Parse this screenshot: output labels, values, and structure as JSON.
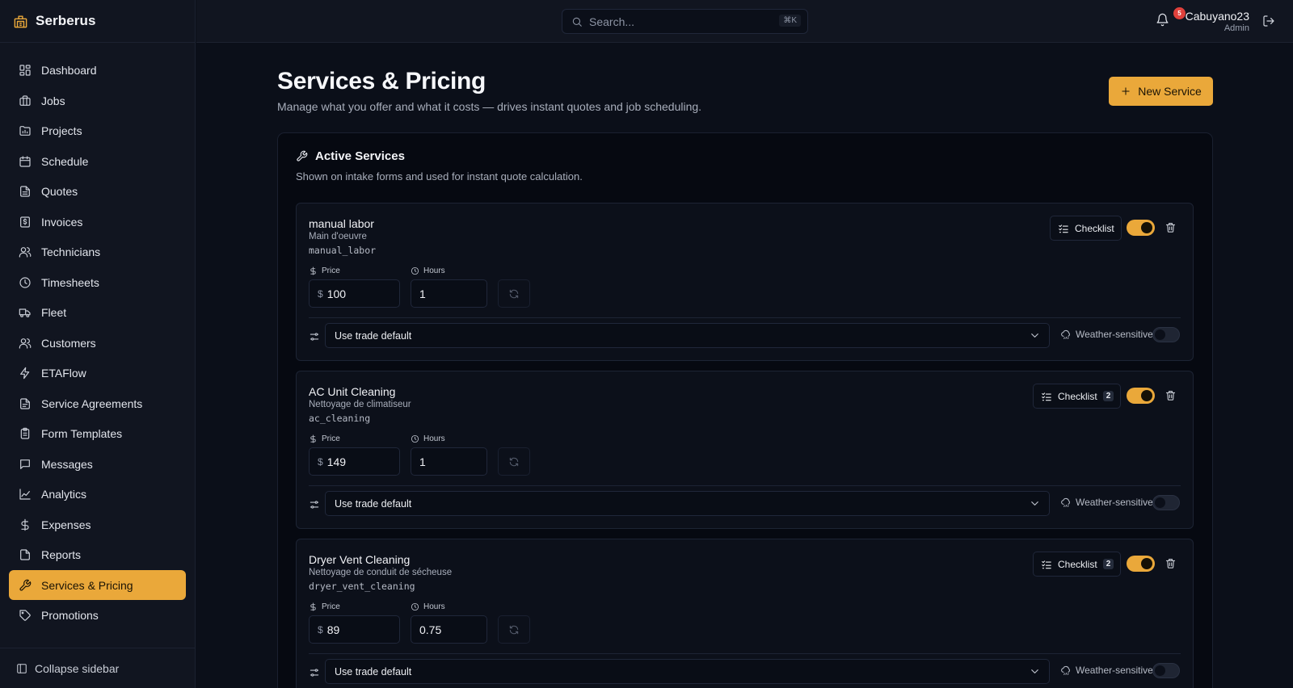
{
  "brand": {
    "name": "Serberus"
  },
  "sidebar": {
    "items": [
      {
        "label": "Dashboard",
        "icon": "dashboard-icon"
      },
      {
        "label": "Jobs",
        "icon": "briefcase-icon"
      },
      {
        "label": "Projects",
        "icon": "folder-chart-icon"
      },
      {
        "label": "Schedule",
        "icon": "calendar-icon"
      },
      {
        "label": "Quotes",
        "icon": "document-icon"
      },
      {
        "label": "Invoices",
        "icon": "invoice-dollar-icon"
      },
      {
        "label": "Technicians",
        "icon": "users-icon"
      },
      {
        "label": "Timesheets",
        "icon": "clock-icon"
      },
      {
        "label": "Fleet",
        "icon": "truck-icon"
      },
      {
        "label": "Customers",
        "icon": "users-icon"
      },
      {
        "label": "ETAFlow",
        "icon": "lightning-icon"
      },
      {
        "label": "Service Agreements",
        "icon": "document-icon"
      },
      {
        "label": "Form Templates",
        "icon": "clipboard-icon"
      },
      {
        "label": "Messages",
        "icon": "message-icon"
      },
      {
        "label": "Analytics",
        "icon": "line-chart-icon"
      },
      {
        "label": "Expenses",
        "icon": "dollar-icon"
      },
      {
        "label": "Reports",
        "icon": "file-icon"
      },
      {
        "label": "Services & Pricing",
        "icon": "wrench-icon",
        "active": true
      },
      {
        "label": "Promotions",
        "icon": "tag-icon"
      }
    ],
    "collapse_label": "Collapse sidebar"
  },
  "topbar": {
    "search_placeholder": "Search...",
    "search_shortcut": "⌘K",
    "notification_count": "5",
    "user_name": "Cabuyano23",
    "user_role": "Admin"
  },
  "page": {
    "title": "Services & Pricing",
    "subtitle": "Manage what you offer and what it costs — drives instant quotes and job scheduling.",
    "new_button": "New Service"
  },
  "panel": {
    "title": "Active Services",
    "subtitle": "Shown on intake forms and used for instant quote calculation."
  },
  "labels": {
    "price": "Price",
    "hours": "Hours",
    "currency": "$",
    "checklist": "Checklist",
    "weather": "Weather-sensitive"
  },
  "services": [
    {
      "name": "manual labor",
      "name_fr": "Main d'oeuvre",
      "key": "manual_labor",
      "price": "100",
      "hours": "1",
      "checklist_count": "",
      "trade_setting": "Use trade default",
      "enabled": true,
      "weather_sensitive": false
    },
    {
      "name": "AC Unit Cleaning",
      "name_fr": "Nettoyage de climatiseur",
      "key": "ac_cleaning",
      "price": "149",
      "hours": "1",
      "checklist_count": "2",
      "trade_setting": "Use trade default",
      "enabled": true,
      "weather_sensitive": false
    },
    {
      "name": "Dryer Vent Cleaning",
      "name_fr": "Nettoyage de conduit de sécheuse",
      "key": "dryer_vent_cleaning",
      "price": "89",
      "hours": "0.75",
      "checklist_count": "2",
      "trade_setting": "Use trade default",
      "enabled": true,
      "weather_sensitive": false
    }
  ],
  "colors": {
    "accent": "#eaa83a",
    "background": "#0b0f19",
    "badge": "#e0413c"
  }
}
